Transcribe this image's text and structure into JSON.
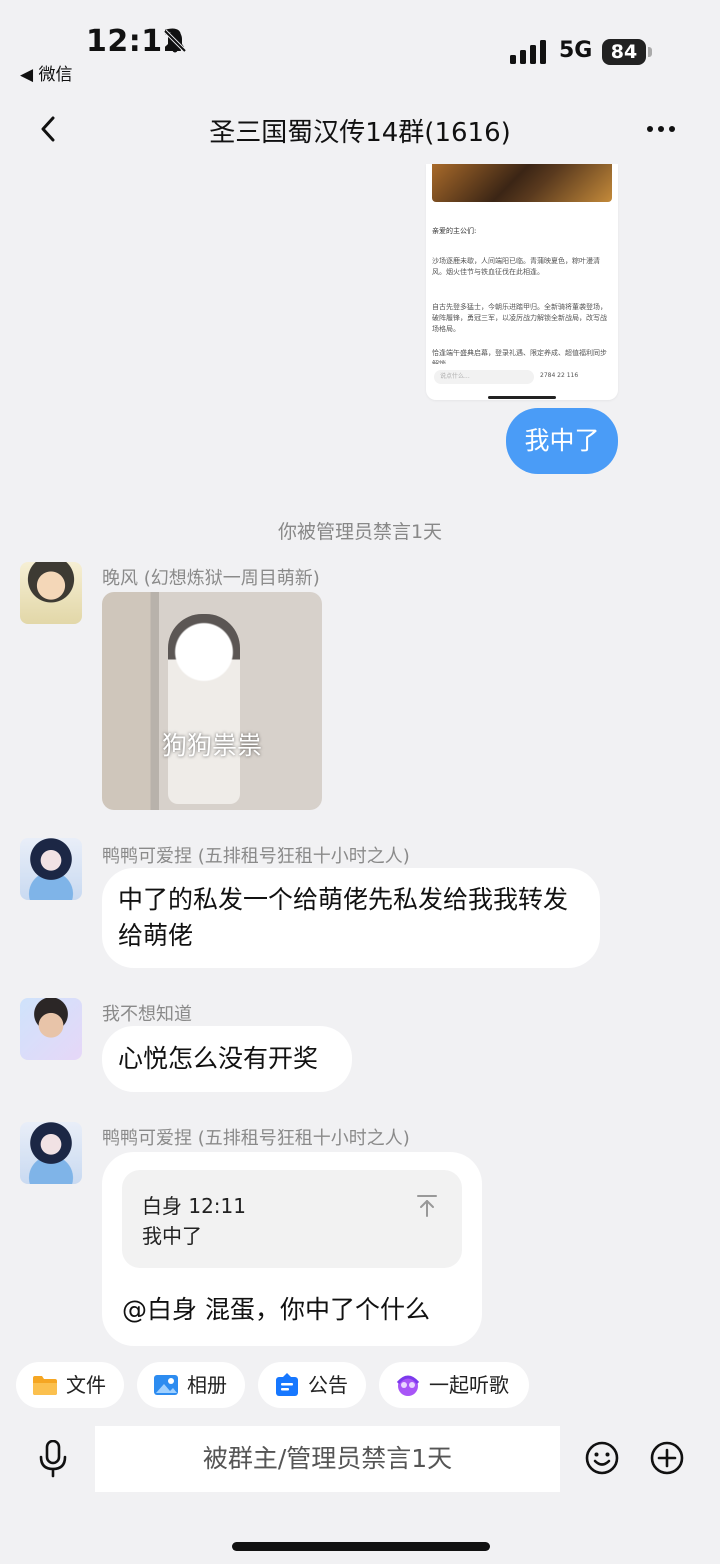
{
  "status_bar": {
    "time": "12:12",
    "back_app": "◀ 微信",
    "network": "5G",
    "battery": "84"
  },
  "nav": {
    "title": "圣三国蜀汉传14群(1616)"
  },
  "messages": {
    "shared_screenshot": {
      "greeting": "亲爱的主公们:",
      "para1": "沙场逐鹿未歇，人间端阳已临。青蒲映夏色，粽叶漫清风。烟火佳节与铁血征伐在此相逢。",
      "para2": "自古先登多猛士，今朝乐进踏甲归。全新骑将董袭登场，破阵履锋，勇冠三军，以凌厉战力解锁全新战局，改写战场格局。",
      "para3": "恰逢端午盛典启幕，登录礼遇、限定养成、超值福利同步解锁。",
      "input_placeholder": "说点什么...",
      "stats": "2784  22  116"
    },
    "mine": {
      "text": "我中了"
    },
    "system_notice": "你被管理员禁言1天",
    "msg1": {
      "sender": "晚风 (幻想炼狱一周目萌新)",
      "sticker_caption": "狗狗祟祟"
    },
    "msg2": {
      "sender": "鸭鸭可爱捏 (五排租号狂租十小时之人)",
      "text": "中了的私发一个给萌佬先私发给我我转发给萌佬"
    },
    "msg3": {
      "sender": "我不想知道",
      "text": "心悦怎么没有开奖"
    },
    "msg4": {
      "sender": "鸭鸭可爱捏 (五排租号狂租十小时之人)",
      "quote_author_time": "白身 12:11",
      "quote_text": "我中了",
      "text": "@白身 混蛋，你中了个什么"
    }
  },
  "shortcuts": {
    "file": "文件",
    "album": "相册",
    "notice": "公告",
    "music": "一起听歌"
  },
  "input": {
    "placeholder": "被群主/管理员禁言1天"
  },
  "colors": {
    "accent": "#4a9cf7",
    "background": "#f1f1f3",
    "bubble": "#ffffff"
  }
}
